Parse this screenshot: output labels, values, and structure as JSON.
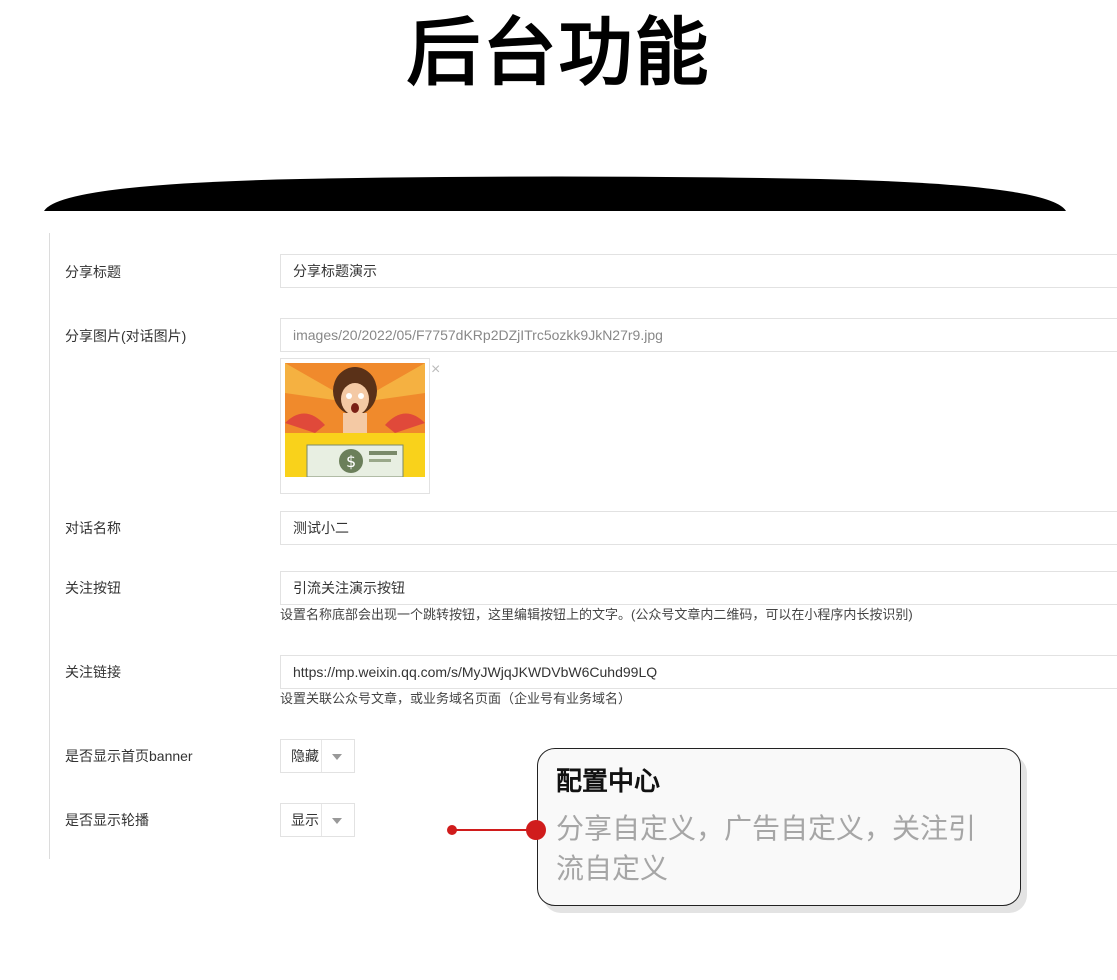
{
  "page_title": "后台功能",
  "form": {
    "share_title": {
      "label": "分享标题",
      "value": "分享标题演示"
    },
    "share_image": {
      "label": "分享图片(对话图片)",
      "value": "images/20/2022/05/F7757dKRp2DZjITrc5ozkk9JkN27r9.jpg",
      "remove_label": "×"
    },
    "dialog_name": {
      "label": "对话名称",
      "value": "测试小二"
    },
    "follow_button": {
      "label": "关注按钮",
      "value": "引流关注演示按钮",
      "hint": "设置名称底部会出现一个跳转按钮，这里编辑按钮上的文字。(公众号文章内二维码，可以在小程序内长按识别)"
    },
    "follow_link": {
      "label": "关注链接",
      "value": "https://mp.weixin.qq.com/s/MyJWjqJKWDVbW6Cuhd99LQ",
      "hint": "设置关联公众号文章，或业务域名页面（企业号有业务域名）"
    },
    "show_banner": {
      "label": "是否显示首页banner",
      "selected": "隐藏"
    },
    "show_carousel": {
      "label": "是否显示轮播",
      "selected": "显示"
    }
  },
  "callout": {
    "title": "配置中心",
    "description": "分享自定义，广告自定义，关注引流自定义",
    "accent_color": "#d01c1c"
  }
}
